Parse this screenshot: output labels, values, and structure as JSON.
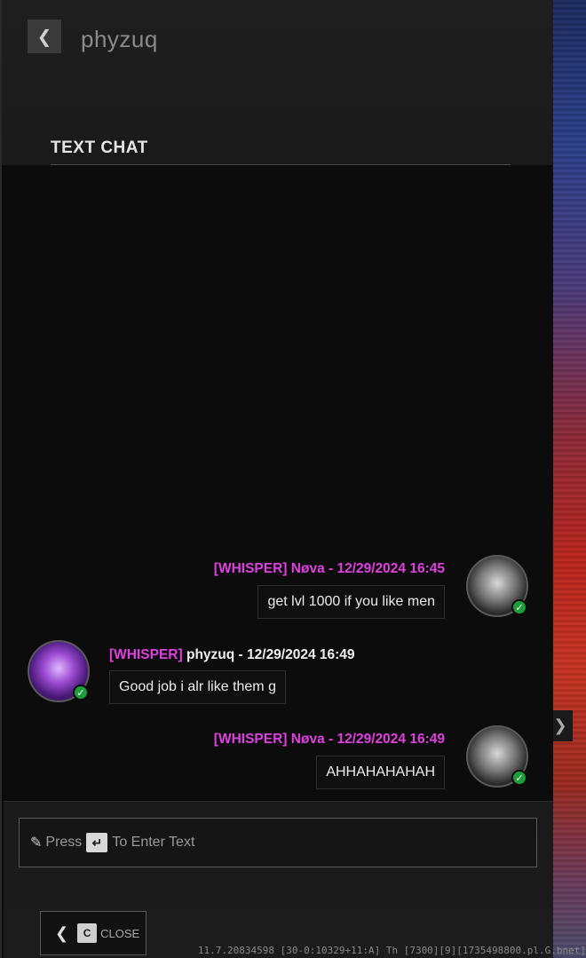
{
  "header": {
    "back_icon": "chevron-left-icon",
    "back_glyph": "❮",
    "title": "phyzuq"
  },
  "section": {
    "title": "TEXT CHAT"
  },
  "messages": [
    {
      "tag": "[WHISPER]",
      "sender": "Nøva",
      "timestamp": "12/29/2024 16:45",
      "separator": " - ",
      "text": "get lvl 1000 if you like men",
      "align": "right",
      "sender_color": "#e040e0"
    },
    {
      "tag": "[WHISPER]",
      "sender": "phyzuq",
      "timestamp": "12/29/2024 16:49",
      "separator": " - ",
      "text": "Good job i alr like them g",
      "align": "left",
      "sender_color": "#f0f0f0"
    },
    {
      "tag": "[WHISPER]",
      "sender": "Nøva",
      "timestamp": "12/29/2024 16:49",
      "separator": " - ",
      "text": "AHHAHAHAHAH",
      "align": "right",
      "sender_color": "#e040e0"
    }
  ],
  "input": {
    "prefix": "Press",
    "key_glyph": "↵",
    "suffix": "To Enter Text",
    "pen_icon": "pen-icon"
  },
  "footer": {
    "close_key": "C",
    "close_label": "CLOSE",
    "build_info": "11.7.20834598 [30-0:10329+11:A] Th [7300][9][1735498800.pl.G.bnet]"
  },
  "side": {
    "right_arrow_glyph": "❯"
  },
  "colors": {
    "whisper_tag": "#e040e0",
    "online_status": "#1f9d3a"
  }
}
